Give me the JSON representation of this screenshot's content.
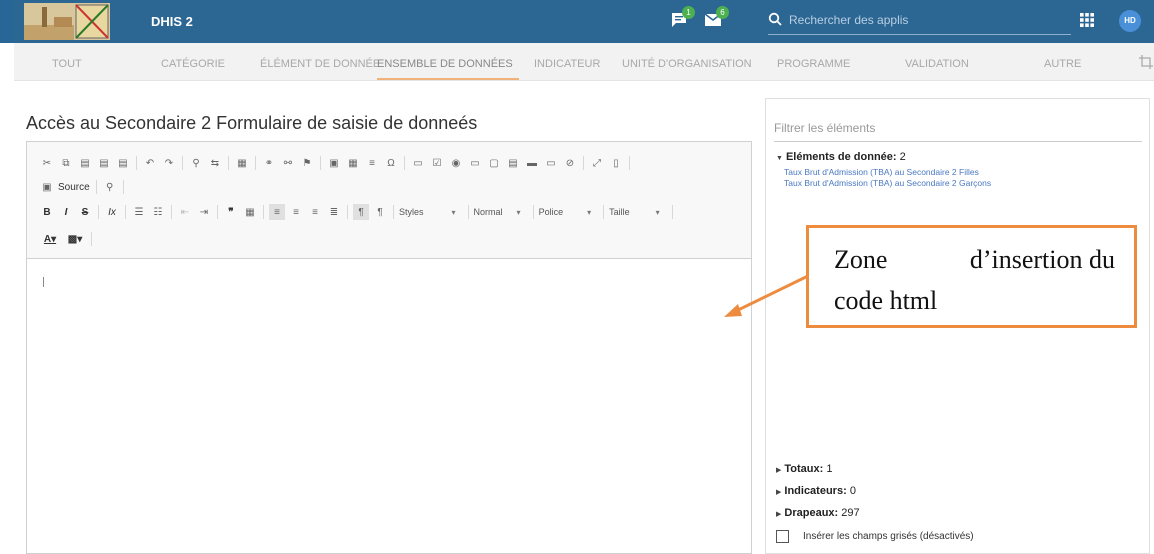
{
  "app": {
    "title": "DHIS 2",
    "avatar_initials": "HD"
  },
  "header": {
    "messages_badge": "1",
    "mail_badge": "6",
    "search_placeholder": "Rechercher des applis"
  },
  "tabs": [
    {
      "label": "TOUT"
    },
    {
      "label": "CATÉGORIE"
    },
    {
      "label": "ÉLÉMENT DE DONNÉE"
    },
    {
      "label": "ENSEMBLE DE DONNÉES"
    },
    {
      "label": "INDICATEUR"
    },
    {
      "label": "UNITÉ D'ORGANISATION"
    },
    {
      "label": "PROGRAMME"
    },
    {
      "label": "VALIDATION"
    },
    {
      "label": "AUTRE"
    }
  ],
  "page": {
    "title": "Accès au Secondaire 2 Formulaire de saisie de donneés"
  },
  "editor": {
    "source_label": "Source",
    "styles_label": "Styles",
    "format_label": "Normal",
    "font_label": "Police",
    "size_label": "Taille"
  },
  "panel": {
    "filter_placeholder": "Filtrer les éléments",
    "data_elements_label": "Eléments de donnée:",
    "data_elements_count": "2",
    "data_elements": [
      "Taux Brut d'Admission (TBA) au Secondaire 2 Filles",
      "Taux Brut d'Admission (TBA) au Secondaire 2 Garçons"
    ],
    "totals_label": "Totaux:",
    "totals_count": "1",
    "indicators_label": "Indicateurs:",
    "indicators_count": "0",
    "flags_label": "Drapeaux:",
    "flags_count": "297",
    "checkbox_label": "Insérer les champs grisés (désactivés)"
  },
  "callout": {
    "line1_word1": "Zone",
    "line1_rest": "d’insertion du",
    "line2": "code html"
  },
  "colors": {
    "header": "#2c6693",
    "accent": "#ed8b3f",
    "link": "#4a78c2"
  }
}
